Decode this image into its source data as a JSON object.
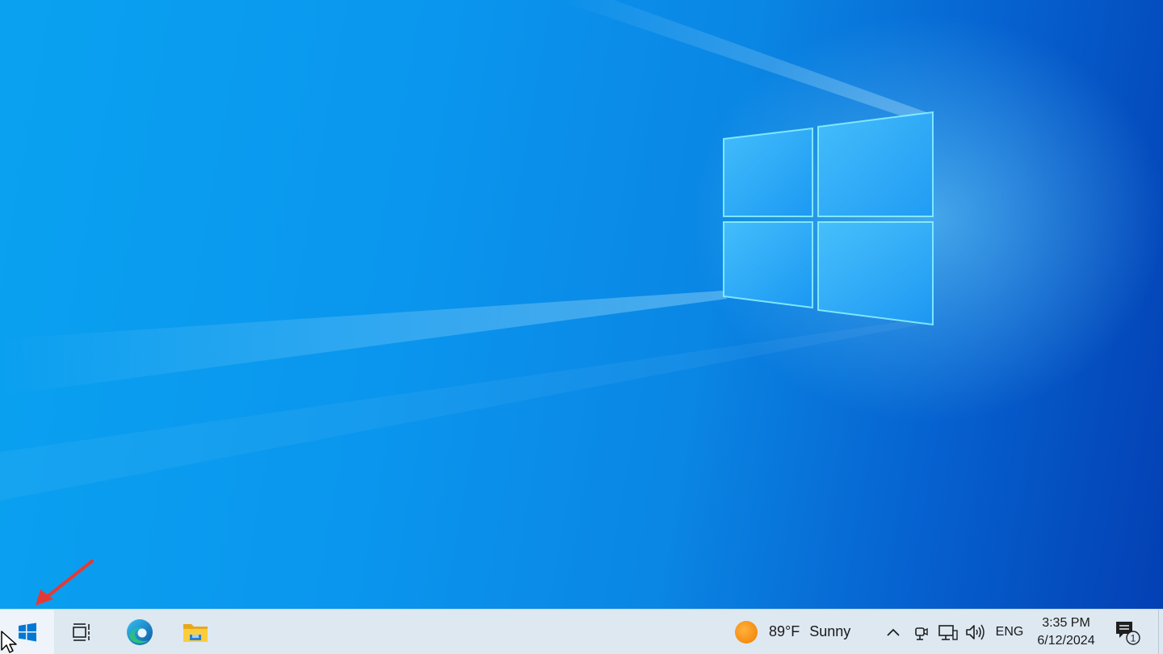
{
  "colors": {
    "taskbar_bg": "#dde8f1",
    "desktop_light": "#0aa2f0",
    "desktop_dark": "#0340b4",
    "windows_blue": "#0078d4",
    "annotation_red": "#e53935"
  },
  "desktop": {
    "wallpaper": "windows-10-logo-light",
    "annotation": "red-arrow-pointing-to-start-button"
  },
  "taskbar": {
    "start_icon": "windows-logo-icon",
    "pinned": [
      {
        "name": "task-view",
        "icon": "task-view-icon"
      },
      {
        "name": "microsoft-edge",
        "icon": "edge-icon"
      },
      {
        "name": "file-explorer",
        "icon": "folder-icon"
      }
    ],
    "weather": {
      "icon": "sun-icon",
      "temperature": "89°F",
      "condition": "Sunny"
    },
    "tray": {
      "chevron_icon": "chevron-up-icon",
      "meet_icon": "meet-now-icon",
      "network_icon": "network-icon",
      "volume_icon": "volume-icon",
      "language": "ENG",
      "time": "3:35 PM",
      "date": "6/12/2024",
      "notifications_icon": "notification-icon",
      "notification_count": "1"
    }
  }
}
